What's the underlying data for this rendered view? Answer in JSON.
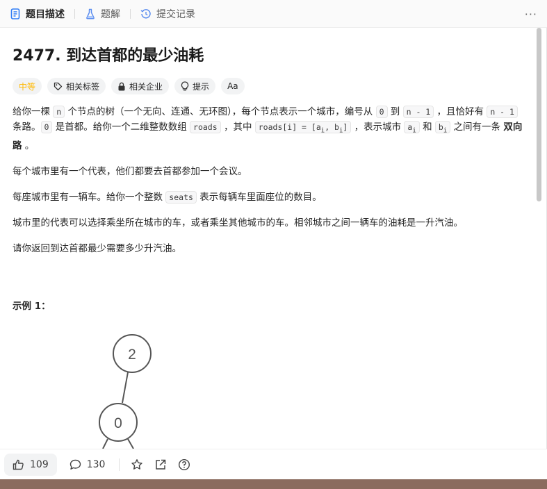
{
  "tabs": [
    {
      "label": "题目描述",
      "icon": "doc-icon"
    },
    {
      "label": "题解",
      "icon": "flask-icon"
    },
    {
      "label": "提交记录",
      "icon": "history-icon"
    }
  ],
  "more_label": "···",
  "problem": {
    "title": "2477. 到达首都的最少油耗",
    "difficulty": "中等",
    "tags": [
      {
        "label": "相关标签",
        "icon": "tag-icon"
      },
      {
        "label": "相关企业",
        "icon": "lock-icon"
      },
      {
        "label": "提示",
        "icon": "bulb-icon"
      },
      {
        "label": "Aa",
        "icon": "translate-icon"
      }
    ]
  },
  "desc": {
    "p1": {
      "t1": "给你一棵 ",
      "c1": "n",
      "t2": " 个节点的树（一个无向、连通、无环图），每个节点表示一个城市，编号从 ",
      "c2": "0",
      "t3": " 到 ",
      "c3": "n - 1",
      "t4": " ，且恰好有 ",
      "c4": "n - 1",
      "t5": " 条路。",
      "c5": "0",
      "t6": " 是首都。给你一个二维整数数组 ",
      "c6": "roads",
      "t7": " ，其中 ",
      "c7a": "roads[i] = [a",
      "c7s1": "i",
      "c7b": ", b",
      "c7s2": "i",
      "c7c": "]",
      "t8": " ，表示城市 ",
      "c8": "a",
      "c8s": "i",
      "t9": " 和 ",
      "c9": "b",
      "c9s": "i",
      "t10": " 之间有一条 ",
      "b1": "双向路",
      "t11": " 。"
    },
    "p2": "每个城市里有一个代表，他们都要去首都参加一个会议。",
    "p3": {
      "t1": "每座城市里有一辆车。给你一个整数 ",
      "c1": "seats",
      "t2": " 表示每辆车里面座位的数目。"
    },
    "p4": "城市里的代表可以选择乘坐所在城市的车，或者乘坐其他城市的车。相邻城市之间一辆车的油耗是一升汽油。",
    "p5": "请你返回到达首都最少需要多少升汽油。",
    "example_title": "示例 1："
  },
  "tree": {
    "nodes": [
      "2",
      "0"
    ]
  },
  "footer": {
    "likes": "109",
    "comments": "130"
  },
  "colors": {
    "difficulty": "#ffb800",
    "accent_blue": "#2f7cf6"
  }
}
